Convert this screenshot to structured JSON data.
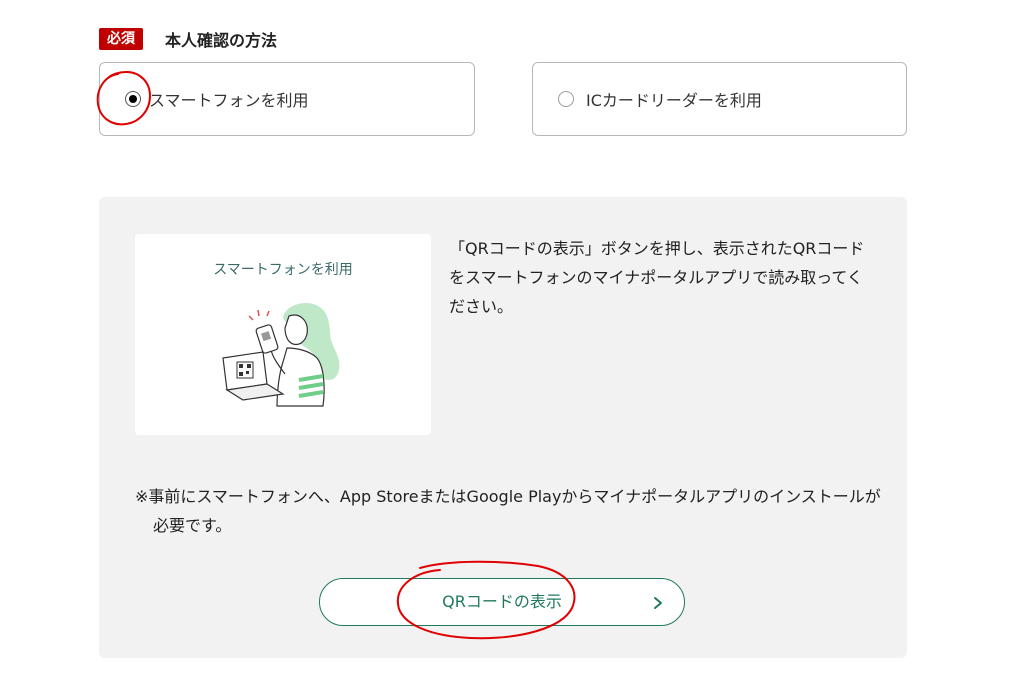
{
  "section": {
    "required_badge": "必須",
    "title": "本人確認の方法"
  },
  "options": [
    {
      "label": "スマートフォンを利用",
      "selected": true
    },
    {
      "label": "ICカードリーダーを利用",
      "selected": false
    }
  ],
  "panel": {
    "illustration_caption": "スマートフォンを利用",
    "instruction": "「QRコードの表示」ボタンを押し、表示されたQRコードをスマートフォンのマイナポータルアプリで読み取ってください。",
    "note": "※事前にスマートフォンへ、App StoreまたはGoogle Playからマイナポータルアプリのインストールが必要です。",
    "button_label": "QRコードの表示"
  },
  "colors": {
    "required_badge": "#c00000",
    "accent_green": "#1f7a5c",
    "annotation_red": "#e00000",
    "panel_bg": "#f2f2f2"
  },
  "icons": [
    "radio-checked-icon",
    "radio-unchecked-icon",
    "chevron-right-icon",
    "smartphone-qr-illustration"
  ]
}
